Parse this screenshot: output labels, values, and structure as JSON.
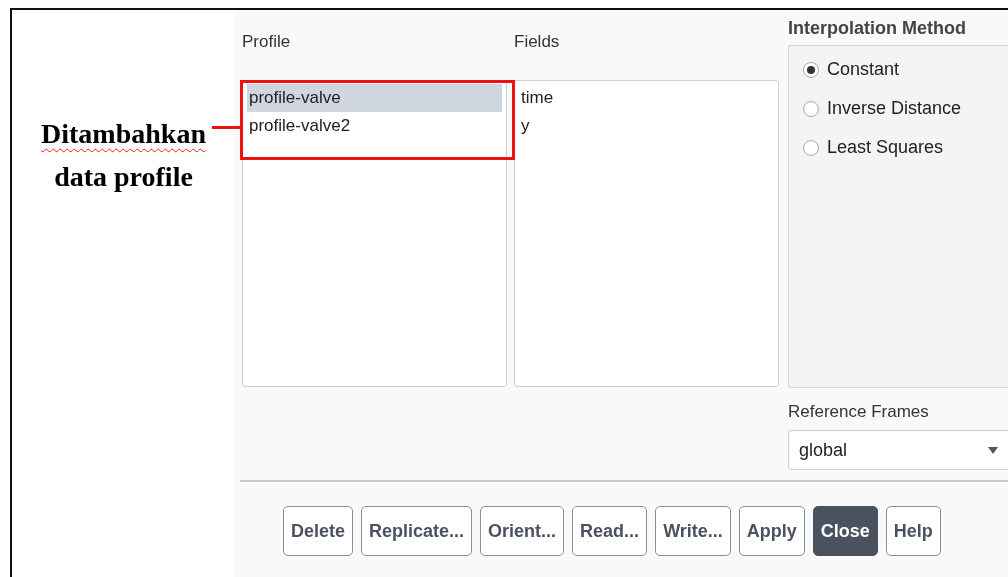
{
  "annotation": {
    "lines": [
      "Ditambahkan",
      "data profile"
    ]
  },
  "profile": {
    "label": "Profile",
    "items": [
      {
        "text": "profile-valve",
        "selected": true
      },
      {
        "text": "profile-valve2",
        "selected": false
      }
    ]
  },
  "fields": {
    "label": "Fields",
    "items": [
      "time",
      "y"
    ]
  },
  "interpolation": {
    "title": "Interpolation Method",
    "options": [
      {
        "label": "Constant",
        "selected": true
      },
      {
        "label": "Inverse Distance",
        "selected": false
      },
      {
        "label": "Least Squares",
        "selected": false
      }
    ]
  },
  "reference_frames": {
    "label": "Reference Frames",
    "value": "global"
  },
  "buttons": [
    {
      "label": "Delete",
      "default": false
    },
    {
      "label": "Replicate...",
      "default": false
    },
    {
      "label": "Orient...",
      "default": false
    },
    {
      "label": "Read...",
      "default": false
    },
    {
      "label": "Write...",
      "default": false
    },
    {
      "label": "Apply",
      "default": false
    },
    {
      "label": "Close",
      "default": true
    },
    {
      "label": "Help",
      "default": false
    }
  ]
}
